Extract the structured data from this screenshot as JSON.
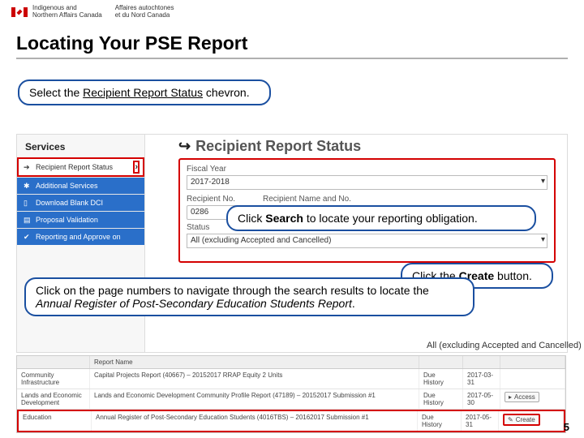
{
  "header": {
    "dept_en1": "Indigenous and",
    "dept_en2": "Northern Affairs Canada",
    "dept_fr1": "Affaires autochtones",
    "dept_fr2": "et du Nord Canada"
  },
  "title": "Locating Your PSE Report",
  "callouts": {
    "c1a": "Select the ",
    "c1b": "Recipient Report Status",
    "c1c": " chevron.",
    "c2a": "Click ",
    "c2b": "Search",
    "c2c": " to locate your reporting obligation.",
    "c3a": "Click the ",
    "c3b": "Create",
    "c3c": " button.",
    "c4a": "Click on the page numbers to navigate through the search results to locate the ",
    "c4b": "Annual Register of Post-Secondary Education Students Report",
    "c4c": "."
  },
  "sidebar": {
    "head": "Services",
    "items": [
      "Recipient Report Status",
      "Additional Services",
      "Download Blank DCI",
      "Proposal Validation",
      "Reporting and Approve on"
    ]
  },
  "panel": {
    "title": "Recipient Report Status",
    "fiscal_label": "Fiscal Year",
    "fiscal_value": "2017-2018",
    "rno_label": "Recipient No.",
    "rname_label": "Recipient Name and No.",
    "rno_value": "0286",
    "status_label": "Status",
    "status_value": "All (excluding Accepted and Cancelled)"
  },
  "summary": {
    "text": "All (excluding Accepted and Cancelled)",
    "prefix": ""
  },
  "table": {
    "head": [
      "",
      "Report Name ",
      "",
      "",
      ""
    ],
    "rows": [
      {
        "cat1": "Community",
        "cat2": "Infrastructure",
        "name": "Capital Projects Report (40667) – 20152017 RRAP Equity 2 Units",
        "status": "Due",
        "hist": "History",
        "date": "2017-03-31",
        "action": ""
      },
      {
        "cat1": "Lands and Economic",
        "cat2": "Development",
        "name": "Lands and Economic Development Community Profile Report (47189) – 20152017 Submission #1",
        "status": "Due",
        "hist": "History",
        "date": "2017-05-30",
        "action": "Access"
      },
      {
        "cat1": "Education",
        "cat2": "",
        "name": "Annual Register of Post-Secondary Education Students (4016TBS) – 20162017 Submission #1",
        "status": "Due",
        "hist": "History",
        "date": "2017-05-31",
        "action": "Create"
      }
    ]
  },
  "page_no": "5"
}
